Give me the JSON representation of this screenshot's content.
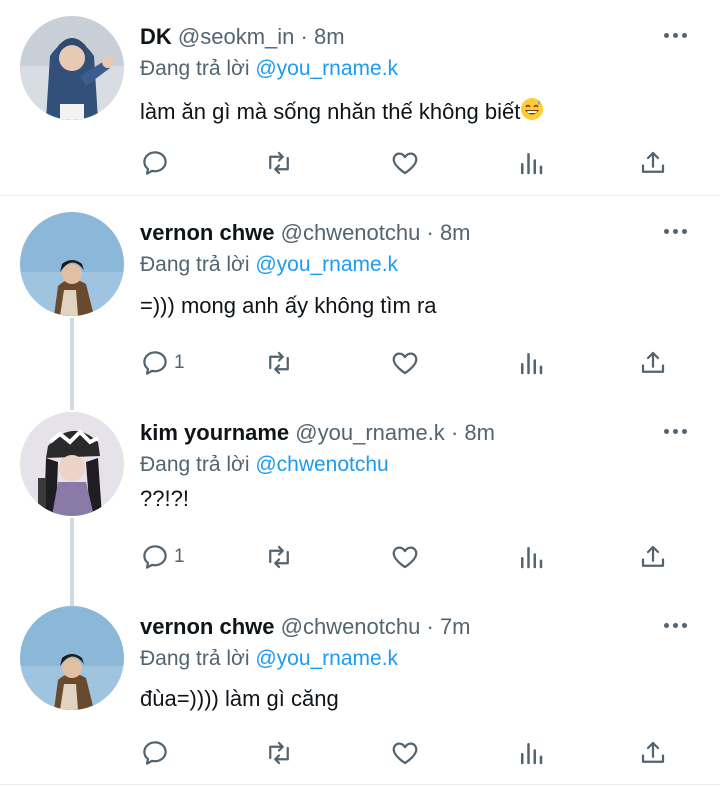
{
  "tweets": [
    {
      "name": "DK",
      "handle": "@seokm_in",
      "dot": "·",
      "time": "8m",
      "reply_prefix": "Đang trả lời",
      "reply_to": "@you_rname.k",
      "text": "làm ăn gì mà sống nhăn thế không biết",
      "emoji": "grinning-sweat-face",
      "reply_count": ""
    },
    {
      "name": "vernon chwe",
      "handle": "@chwenotchu",
      "dot": "·",
      "time": "8m",
      "reply_prefix": "Đang trả lời",
      "reply_to": "@you_rname.k",
      "text": "=))) mong anh ấy không tìm ra",
      "reply_count": "1"
    },
    {
      "name": "kim yourname",
      "handle": "@you_rname.k",
      "dot": "·",
      "time": "8m",
      "reply_prefix": "Đang trả lời",
      "reply_to": "@chwenotchu",
      "text": "??!?!",
      "reply_count": "1"
    },
    {
      "name": "vernon chwe",
      "handle": "@chwenotchu",
      "dot": "·",
      "time": "7m",
      "reply_prefix": "Đang trả lời",
      "reply_to": "@you_rname.k",
      "text": "đùa=)))) làm gì căng",
      "reply_count": ""
    }
  ],
  "icons": {
    "more": "more-dots-icon",
    "reply": "reply-bubble-icon",
    "retweet": "retweet-icon",
    "like": "heart-icon",
    "views": "views-chart-icon",
    "share": "share-icon"
  },
  "colors": {
    "name": "#0f1419",
    "secondary": "#536471",
    "mention": "#1d9bf0",
    "divider": "#e6ecf0",
    "thread_line": "#cfd9de"
  }
}
